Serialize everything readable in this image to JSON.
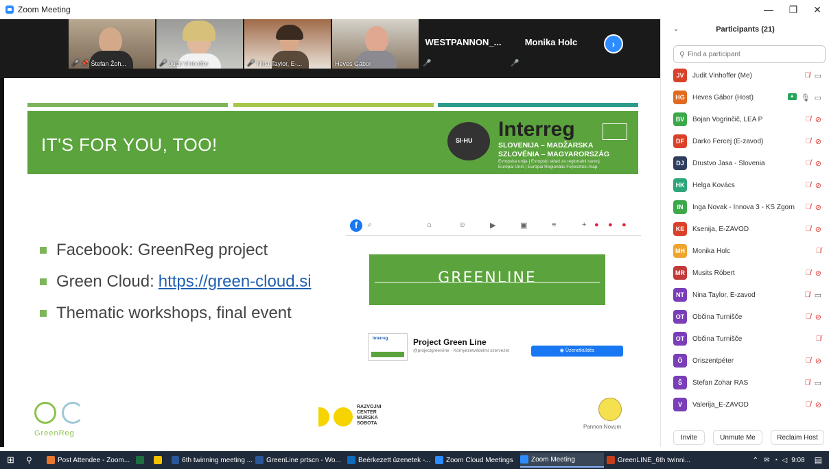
{
  "window": {
    "title": "Zoom Meeting",
    "controls": {
      "minimize": "—",
      "restore": "❐",
      "close": "✕"
    }
  },
  "video_strip": {
    "tiles": [
      {
        "name": "Štefan Žoh...",
        "muted": true,
        "pinned": true
      },
      {
        "name": "Judit Vinhoffer",
        "muted": true
      },
      {
        "name": "Nina Taylor, E-...",
        "muted": true
      },
      {
        "name": "Heves Gábor",
        "muted": false
      }
    ],
    "name_tiles": [
      {
        "name": "WESTPANNON_...",
        "muted": true
      },
      {
        "name": "Monika Holc",
        "muted": true
      }
    ],
    "next_icon": "chevron-right-icon"
  },
  "slide": {
    "headline": "IT'S FOR YOU, TOO!",
    "interreg": {
      "logo_text": "SI-HU",
      "name": "Interreg",
      "line1": "SLOVENIJA – MADŽARSKA",
      "line2": "SZLOVÉNIA – MAGYARORSZÁG",
      "line3": "Evropska unija | Evropski sklad za regionalni razvoj",
      "line4": "Európai Unió | Európai Regionális Fejlesztési Alap"
    },
    "bullets": [
      {
        "text": "Facebook: GreenReg project",
        "link": ""
      },
      {
        "text": "Green Cloud:",
        "link": "https://green-cloud.si"
      },
      {
        "text": "Thematic workshops, final event",
        "link": ""
      }
    ],
    "facebook": {
      "cover_text": "GREENLINE",
      "page_name": "Project Green Line",
      "page_sub": "@projectgreenline · Környezetvédelmi szervezet",
      "button": "Üzenetküldés",
      "profile_text": "Interreg"
    },
    "footer": {
      "greenreg": "GreenReg",
      "rcms_lines": [
        "RAZVOJNI",
        "CENTER",
        "MURSKA",
        "SOBOTA"
      ],
      "pannon": "Pannon Novum"
    },
    "colors": {
      "green": "#5BA33C",
      "stripe_left": "#7DB55A",
      "stripe_mid": "#A8C74A",
      "stripe_right": "#2E9C8C"
    }
  },
  "participants": {
    "title": "Participants (21)",
    "search_placeholder": "Find a participant",
    "list": [
      {
        "initials": "JV",
        "name": "Judit Vinhoffer (Me)",
        "color": "#D9412A",
        "mic": "off",
        "cam": "on"
      },
      {
        "initials": "HG",
        "name": "Heves Gábor (Host)",
        "color": "#E06A1F",
        "mic": "on",
        "cam": "on",
        "sharing": true
      },
      {
        "initials": "BV",
        "name": "Bojan Vogrinčič, LEA P",
        "color": "#3BA84A",
        "mic": "off",
        "cam": "off"
      },
      {
        "initials": "DF",
        "name": "Darko Fercej (E-zavod)",
        "color": "#D9412A",
        "mic": "off",
        "cam": "off"
      },
      {
        "initials": "DJ",
        "name": "Drustvo Jasa - Slovenia",
        "color": "#2F3E5C",
        "mic": "off",
        "cam": "off"
      },
      {
        "initials": "HK",
        "name": "Helga Kovács",
        "color": "#2FA67A",
        "mic": "off",
        "cam": "off"
      },
      {
        "initials": "IN",
        "name": "Inga Novak - Innova 3 - KS Zgorn...",
        "color": "#3BA84A",
        "mic": "off",
        "cam": "off"
      },
      {
        "initials": "KE",
        "name": "Ksenija, E-ZAVOD",
        "color": "#D9412A",
        "mic": "off",
        "cam": "off"
      },
      {
        "initials": "MH",
        "name": "Monika Holc",
        "color": "#F0A430",
        "mic": "off",
        "cam": ""
      },
      {
        "initials": "MR",
        "name": "Musits Róbert",
        "color": "#C23B3B",
        "mic": "off",
        "cam": "off"
      },
      {
        "initials": "NT",
        "name": "Nina Taylor, E-zavod",
        "color": "#7A3EB8",
        "mic": "off",
        "cam": "on"
      },
      {
        "initials": "OT",
        "name": "Občina Turnišče",
        "color": "#7A3EB8",
        "mic": "off",
        "cam": "off"
      },
      {
        "initials": "OT",
        "name": "Občina Turnišče",
        "color": "#7A3EB8",
        "mic": "off",
        "cam": ""
      },
      {
        "initials": "Ő",
        "name": "Őriszentpéter",
        "color": "#7A3EB8",
        "mic": "off",
        "cam": "off"
      },
      {
        "initials": "Š",
        "name": "Štefan Žohar RAS",
        "color": "#7A3EB8",
        "mic": "off",
        "cam": "on"
      },
      {
        "initials": "V",
        "name": "Valerija_E-ZAVOD",
        "color": "#7A3EB8",
        "mic": "off",
        "cam": "off"
      }
    ],
    "buttons": {
      "invite": "Invite",
      "unmute": "Unmute Me",
      "reclaim": "Reclaim Host"
    }
  },
  "taskbar": {
    "items": [
      {
        "label": "Post Attendee - Zoom...",
        "color": "#E8772E"
      },
      {
        "label": "",
        "color": "#1D6F42"
      },
      {
        "label": "",
        "color": "#F2C200"
      },
      {
        "label": "6th twinning meeting ...",
        "color": "#2B579A"
      },
      {
        "label": "GreenLine prtscn - Wo...",
        "color": "#2B579A"
      },
      {
        "label": "Beérkezett üzenetek -...",
        "color": "#0F6CBD"
      },
      {
        "label": "Zoom Cloud Meetings",
        "color": "#2D8CFF"
      },
      {
        "label": "Zoom Meeting",
        "color": "#2D8CFF"
      },
      {
        "label": "GreenLINE_6th twinni...",
        "color": "#C43E1C"
      }
    ],
    "time": "9:08"
  }
}
